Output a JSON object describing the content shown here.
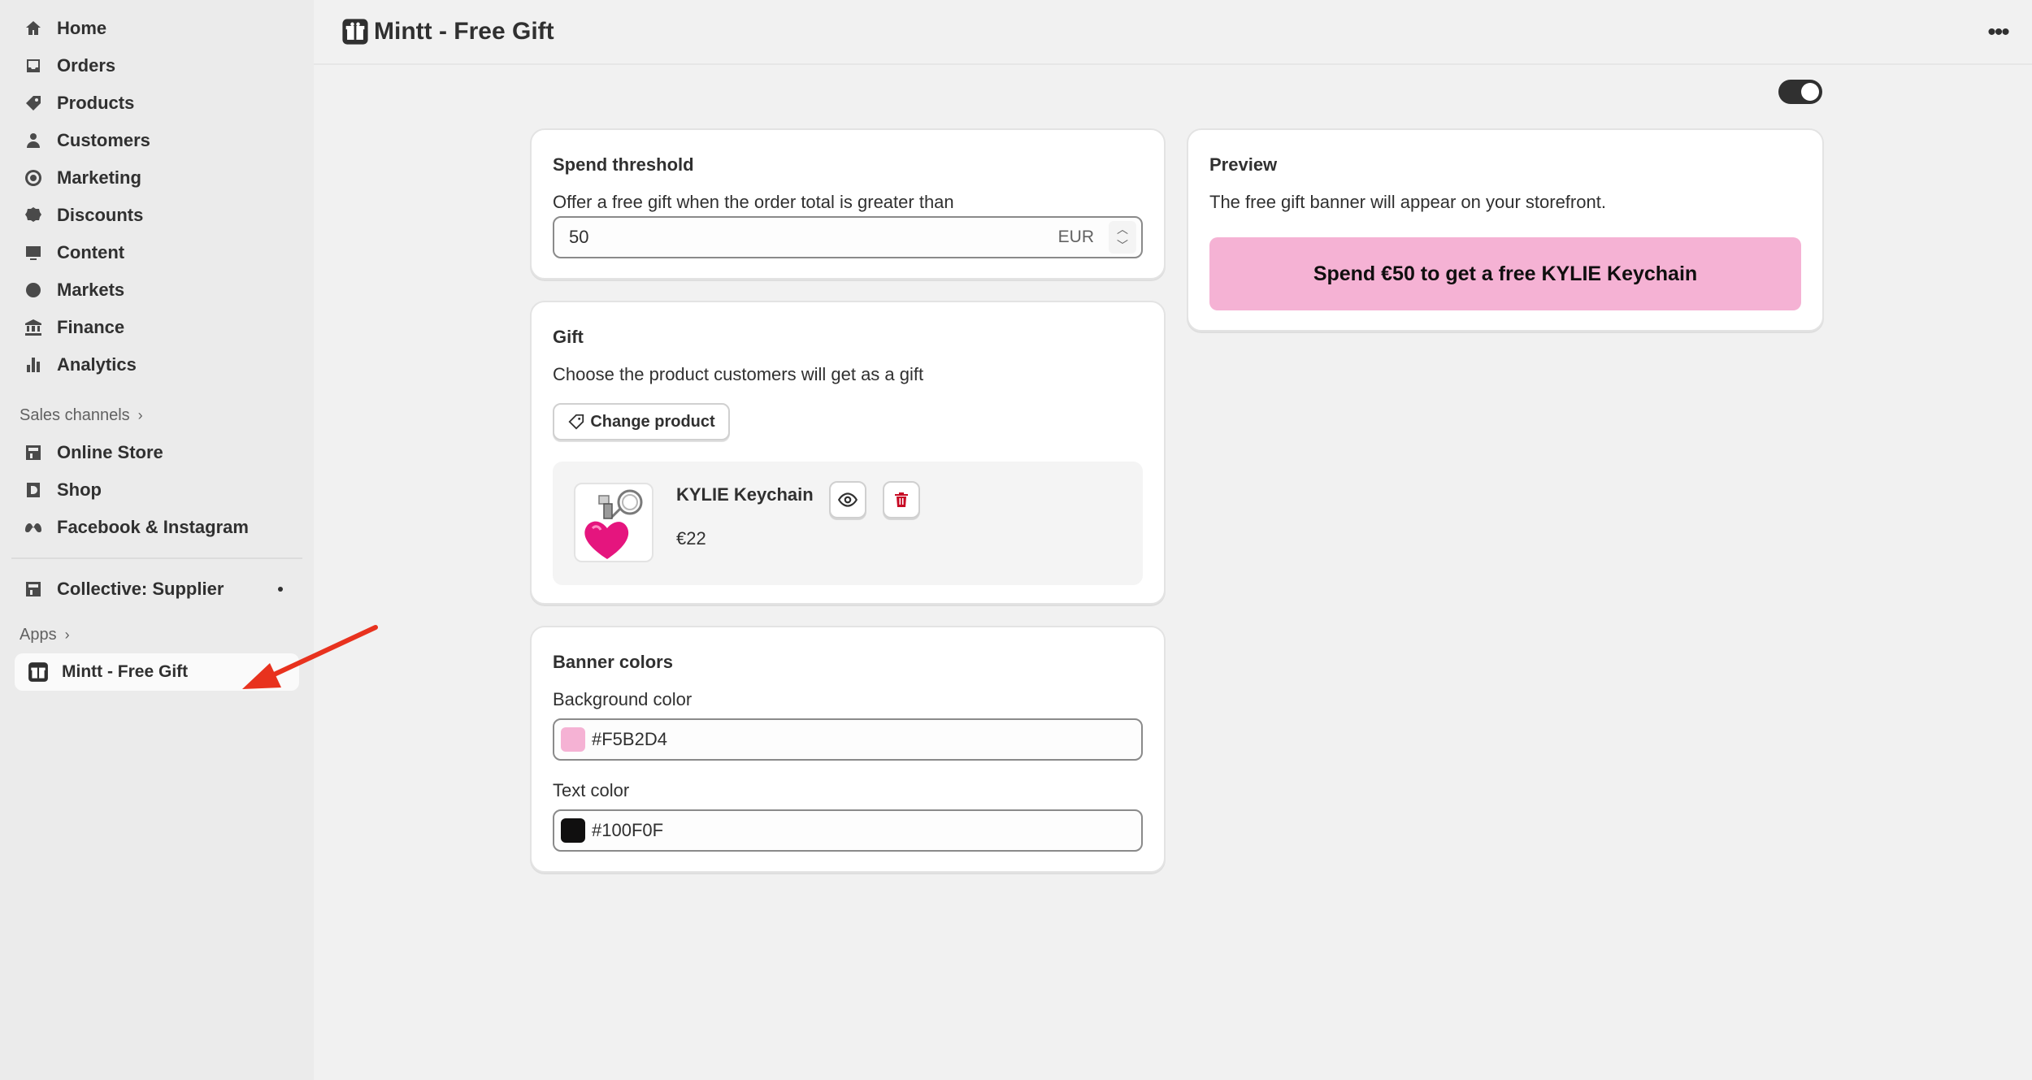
{
  "sidebar": {
    "items": [
      {
        "label": "Home",
        "icon": "home-icon"
      },
      {
        "label": "Orders",
        "icon": "inbox-icon"
      },
      {
        "label": "Products",
        "icon": "tag-icon"
      },
      {
        "label": "Customers",
        "icon": "person-icon"
      },
      {
        "label": "Marketing",
        "icon": "target-icon"
      },
      {
        "label": "Discounts",
        "icon": "discount-icon"
      },
      {
        "label": "Content",
        "icon": "content-icon"
      },
      {
        "label": "Markets",
        "icon": "globe-icon"
      },
      {
        "label": "Finance",
        "icon": "bank-icon"
      },
      {
        "label": "Analytics",
        "icon": "bar-chart-icon"
      }
    ],
    "sales_channels_label": "Sales channels",
    "channels": [
      {
        "label": "Online Store",
        "icon": "store-icon"
      },
      {
        "label": "Shop",
        "icon": "shop-icon"
      },
      {
        "label": "Facebook & Instagram",
        "icon": "meta-icon"
      }
    ],
    "collective_label": "Collective: Supplier",
    "apps_label": "Apps",
    "active_app_label": "Mintt - Free Gift"
  },
  "header": {
    "title": "Mintt - Free Gift"
  },
  "threshold": {
    "heading": "Spend threshold",
    "description": "Offer a free gift when the order total is greater than",
    "value": "50",
    "currency": "EUR"
  },
  "gift": {
    "heading": "Gift",
    "description": "Choose the product customers will get as a gift",
    "change_button": "Change product",
    "product_name": "KYLIE Keychain",
    "product_price": "€22"
  },
  "banner_colors": {
    "heading": "Banner colors",
    "background_label": "Background color",
    "background_value": "#F5B2D4",
    "text_label": "Text color",
    "text_value": "#100F0F"
  },
  "preview": {
    "heading": "Preview",
    "description": "The free gift banner will appear on your storefront.",
    "banner_text": "Spend €50 to get a free KYLIE Keychain"
  },
  "colors": {
    "banner_bg": "#F5B2D4",
    "banner_text": "#100F0F",
    "annotation_arrow": "#E8321E",
    "delete_red": "#C70A24"
  }
}
